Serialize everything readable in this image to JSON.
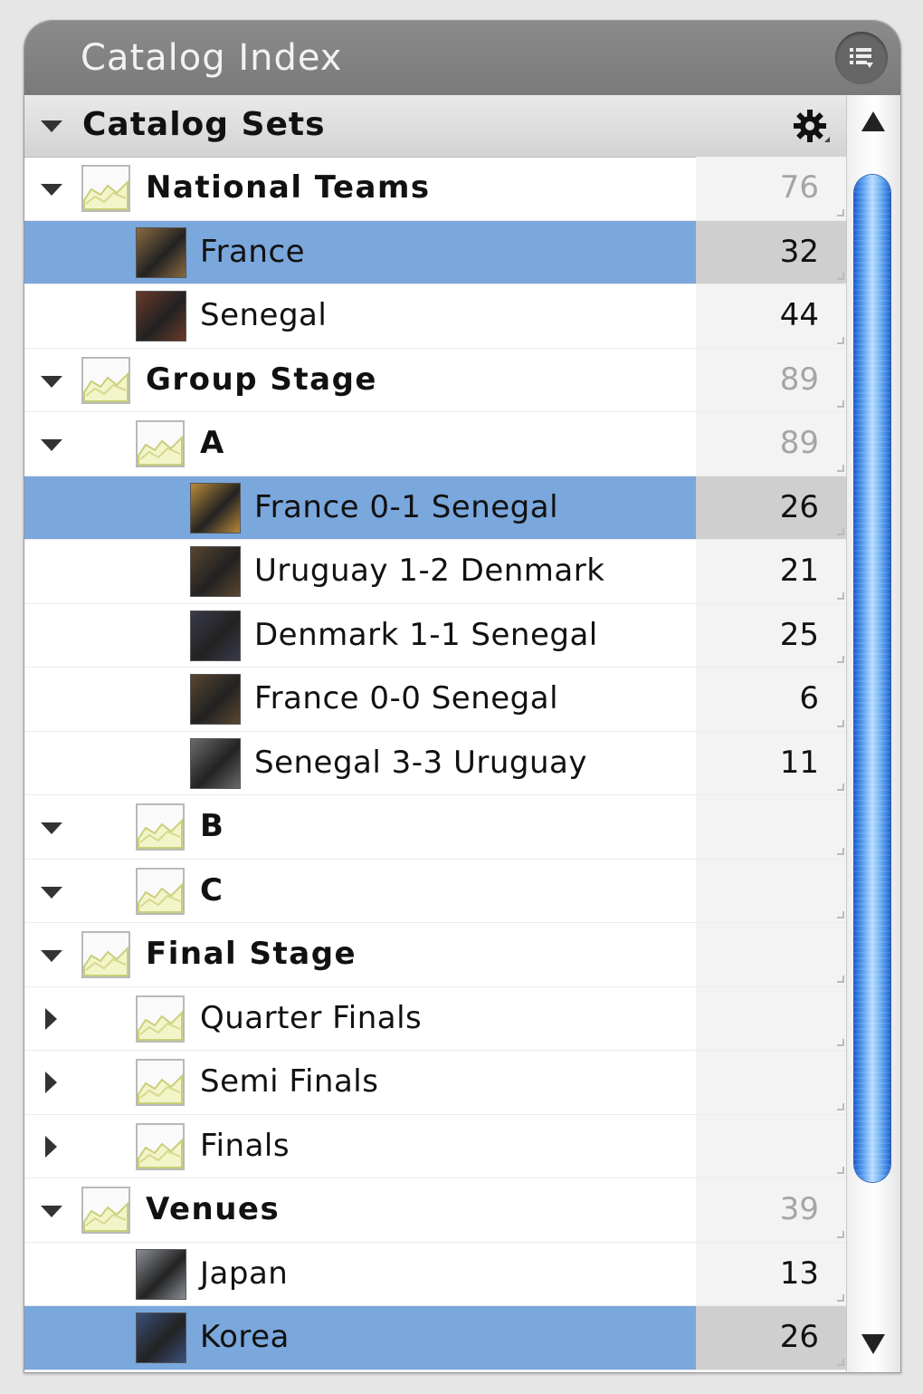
{
  "window": {
    "title": "Catalog Index"
  },
  "header": {
    "label": "Catalog Sets",
    "gear_icon": "gear-icon"
  },
  "rows": [
    {
      "label": "National Teams",
      "count": "76",
      "level": 0,
      "kind": "folder",
      "disclosure": "open",
      "selected": false,
      "dim": true
    },
    {
      "label": "France",
      "count": "32",
      "level": 1,
      "kind": "thumb",
      "disclosure": "none",
      "selected": true,
      "dim": false,
      "thumb_color": "#8a6a40"
    },
    {
      "label": "Senegal",
      "count": "44",
      "level": 1,
      "kind": "thumb",
      "disclosure": "none",
      "selected": false,
      "dim": false,
      "thumb_color": "#6a3a2a"
    },
    {
      "label": "Group Stage",
      "count": "89",
      "level": 0,
      "kind": "folder",
      "disclosure": "open",
      "selected": false,
      "dim": true
    },
    {
      "label": "A",
      "count": "89",
      "level": 1,
      "kind": "folder",
      "disclosure": "open",
      "selected": false,
      "dim": true,
      "bold": true
    },
    {
      "label": "France 0-1 Senegal",
      "count": "26",
      "level": 2,
      "kind": "thumb",
      "disclosure": "none",
      "selected": true,
      "dim": false,
      "thumb_color": "#b88a3a"
    },
    {
      "label": "Uruguay 1-2 Denmark",
      "count": "21",
      "level": 2,
      "kind": "thumb",
      "disclosure": "none",
      "selected": false,
      "dim": false,
      "thumb_color": "#5a4530"
    },
    {
      "label": "Denmark 1-1 Senegal",
      "count": "25",
      "level": 2,
      "kind": "thumb",
      "disclosure": "none",
      "selected": false,
      "dim": false,
      "thumb_color": "#3a3a4a"
    },
    {
      "label": "France 0-0 Senegal",
      "count": "6",
      "level": 2,
      "kind": "thumb",
      "disclosure": "none",
      "selected": false,
      "dim": false,
      "thumb_color": "#5a4530"
    },
    {
      "label": "Senegal 3-3 Uruguay",
      "count": "11",
      "level": 2,
      "kind": "thumb",
      "disclosure": "none",
      "selected": false,
      "dim": false,
      "thumb_color": "#6a6a6a"
    },
    {
      "label": "B",
      "count": "",
      "level": 1,
      "kind": "folder",
      "disclosure": "open",
      "selected": false,
      "dim": false,
      "bold": true
    },
    {
      "label": "C",
      "count": "",
      "level": 1,
      "kind": "folder",
      "disclosure": "open",
      "selected": false,
      "dim": false,
      "bold": true
    },
    {
      "label": "Final Stage",
      "count": "",
      "level": 0,
      "kind": "folder",
      "disclosure": "open",
      "selected": false,
      "dim": false
    },
    {
      "label": "Quarter Finals",
      "count": "",
      "level": 1,
      "kind": "folder",
      "disclosure": "closed",
      "selected": false,
      "dim": false
    },
    {
      "label": "Semi Finals",
      "count": "",
      "level": 1,
      "kind": "folder",
      "disclosure": "closed",
      "selected": false,
      "dim": false
    },
    {
      "label": "Finals",
      "count": "",
      "level": 1,
      "kind": "folder",
      "disclosure": "closed",
      "selected": false,
      "dim": false
    },
    {
      "label": "Venues",
      "count": "39",
      "level": 0,
      "kind": "folder",
      "disclosure": "open",
      "selected": false,
      "dim": true
    },
    {
      "label": "Japan",
      "count": "13",
      "level": 1,
      "kind": "thumb",
      "disclosure": "none",
      "selected": false,
      "dim": false,
      "thumb_color": "#8a8f96"
    },
    {
      "label": "Korea",
      "count": "26",
      "level": 1,
      "kind": "thumb",
      "disclosure": "none",
      "selected": true,
      "dim": false,
      "thumb_color": "#3a4f7a"
    }
  ],
  "colors": {
    "selection": "#7aa7dc",
    "titlebar": "#808080",
    "scroll_thumb": "#3a82e6"
  }
}
